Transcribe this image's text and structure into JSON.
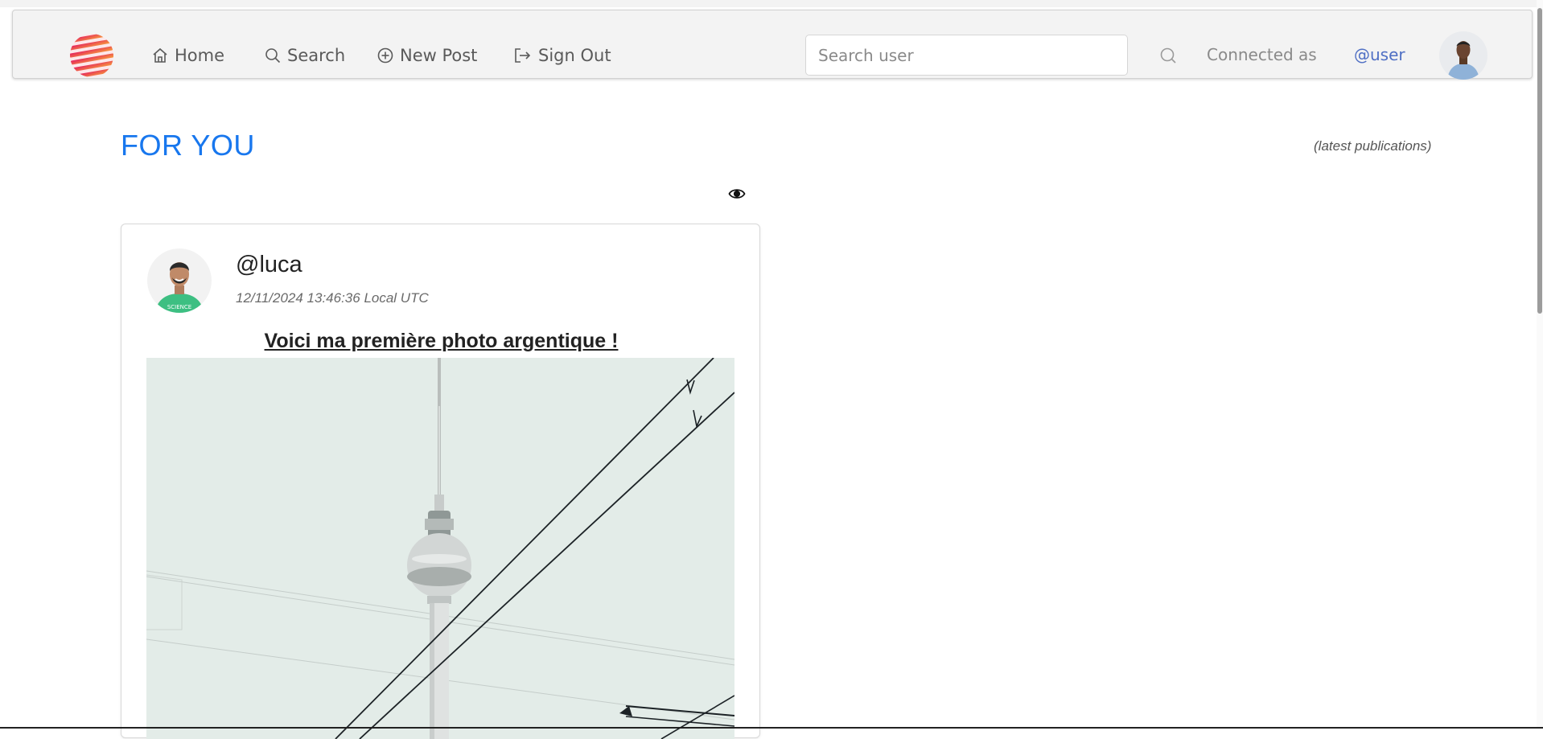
{
  "navbar": {
    "logo": "app-logo",
    "items": [
      {
        "label": "Home",
        "icon": "home-icon"
      },
      {
        "label": "Search",
        "icon": "search-icon"
      },
      {
        "label": "New Post",
        "icon": "plus-circle-icon"
      },
      {
        "label": "Sign Out",
        "icon": "sign-out-icon"
      }
    ],
    "search": {
      "placeholder": "Search user",
      "value": ""
    },
    "connected_label": "Connected as",
    "username": "@user"
  },
  "feed": {
    "title": "FOR YOU",
    "subtitle": "(latest publications)"
  },
  "post": {
    "author": "@luca",
    "date": "12/11/2024 13:46:36 Local UTC",
    "title": "Voici ma première photo argentique !"
  },
  "colors": {
    "accent": "#1877ee",
    "user_link": "#4f6fc4",
    "navbar_bg": "#f3f3f3"
  }
}
